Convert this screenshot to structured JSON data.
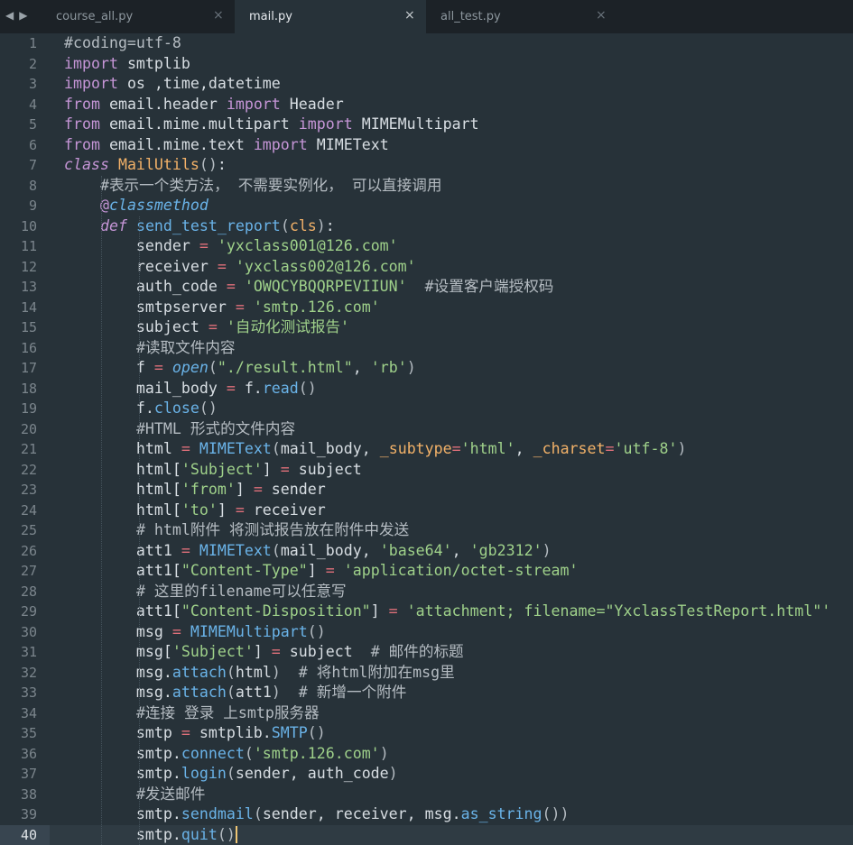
{
  "tabs": [
    {
      "label": "course_all.py",
      "active": false
    },
    {
      "label": "mail.py",
      "active": true
    },
    {
      "label": "all_test.py",
      "active": false
    }
  ],
  "close_glyph": "×",
  "nav": {
    "back": "◀",
    "forward": "▶"
  },
  "current_line": 40,
  "lines": [
    "#coding=utf-8",
    "import smtplib",
    "import os ,time,datetime",
    "from email.header import Header",
    "from email.mime.multipart import MIMEMultipart",
    "from email.mime.text import MIMEText",
    "class MailUtils():",
    "    #表示一个类方法， 不需要实例化， 可以直接调用",
    "    @classmethod",
    "    def send_test_report(cls):",
    "        sender = 'yxclass001@126.com'",
    "        receiver = 'yxclass002@126.com'",
    "        auth_code = 'OWQCYBQQRPEVIIUN'  #设置客户端授权码",
    "        smtpserver = 'smtp.126.com'",
    "        subject = '自动化测试报告'",
    "        #读取文件内容",
    "        f = open(\"./result.html\", 'rb')",
    "        mail_body = f.read()",
    "        f.close()",
    "        #HTML 形式的文件内容",
    "        html = MIMEText(mail_body, _subtype='html', _charset='utf-8')",
    "        html['Subject'] = subject",
    "        html['from'] = sender",
    "        html['to'] = receiver",
    "        # html附件 将测试报告放在附件中发送",
    "        att1 = MIMEText(mail_body, 'base64', 'gb2312')",
    "        att1[\"Content-Type\"] = 'application/octet-stream'",
    "        # 这里的filename可以任意写",
    "        att1[\"Content-Disposition\"] = 'attachment; filename=\"YxclassTestReport.html\"'",
    "        msg = MIMEMultipart()",
    "        msg['Subject'] = subject  # 邮件的标题",
    "        msg.attach(html)  # 将html附加在msg里",
    "        msg.attach(att1)  # 新增一个附件",
    "        #连接 登录 上smtp服务器",
    "        smtp = smtplib.SMTP()",
    "        smtp.connect('smtp.126.com')",
    "        smtp.login(sender, auth_code)",
    "        #发送邮件",
    "        smtp.sendmail(sender, receiver, msg.as_string())",
    "        smtp.quit()"
  ]
}
